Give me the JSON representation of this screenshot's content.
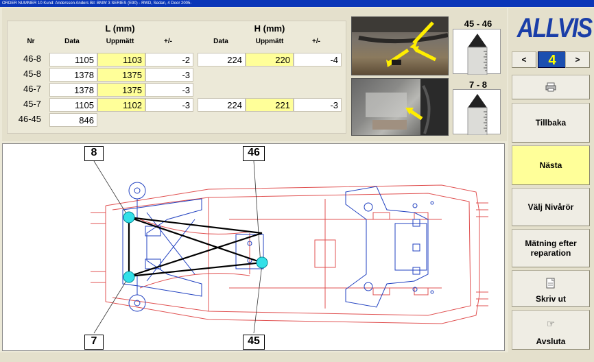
{
  "titlebar": {
    "text": "ORDER NUMMER  10    Kund: Andersson Anders    Bil: BMW  3 SERIES (E90) - RWD, Sedan, 4 Door  2005-"
  },
  "table": {
    "group_l": "L (mm)",
    "group_h": "H (mm)",
    "col_nr": "Nr",
    "col_data": "Data",
    "col_uppmatt": "Uppmätt",
    "col_diff": "+/-",
    "rows": [
      {
        "nr": "46-8",
        "l_data": "1105",
        "l_meas": "1103",
        "l_diff": "-2",
        "h_data": "224",
        "h_meas": "220",
        "h_diff": "-4"
      },
      {
        "nr": "45-8",
        "l_data": "1378",
        "l_meas": "1375",
        "l_diff": "-3",
        "h_data": "",
        "h_meas": "",
        "h_diff": ""
      },
      {
        "nr": "46-7",
        "l_data": "1378",
        "l_meas": "1375",
        "l_diff": "-3",
        "h_data": "",
        "h_meas": "",
        "h_diff": ""
      },
      {
        "nr": "45-7",
        "l_data": "1105",
        "l_meas": "1102",
        "l_diff": "-3",
        "h_data": "224",
        "h_meas": "221",
        "h_diff": "-3"
      },
      {
        "nr": "46-45",
        "l_data": "846",
        "l_meas": "",
        "l_diff": "",
        "h_data": "",
        "h_meas": "",
        "h_diff": ""
      }
    ]
  },
  "gauges": {
    "top_label": "45 - 46",
    "bottom_label": "7 - 8"
  },
  "diagram": {
    "labels": {
      "p8": "8",
      "p46": "46",
      "p7": "7",
      "p45": "45"
    }
  },
  "sidebar": {
    "logo": "ALLVIS",
    "prev": "<",
    "page": "4",
    "next": ">",
    "print_icon": "printer-icon",
    "tillbaka": "Tillbaka",
    "nasta": "Nästa",
    "valj_nivaror": "Välj Nivårör",
    "matning": "Mätning efter reparation",
    "skriv_ut": "Skriv ut",
    "avsluta": "Avsluta"
  },
  "colors": {
    "accent_blue": "#1c4fb0",
    "highlight_yellow": "#ffff99",
    "frame_red": "#e05050",
    "part_blue": "#2040c0",
    "point_cyan": "#33e0e8"
  }
}
